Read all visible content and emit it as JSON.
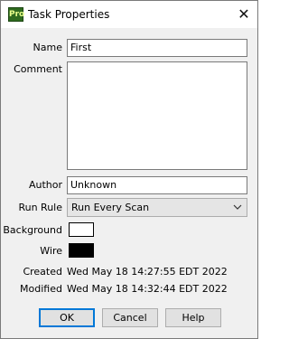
{
  "window": {
    "title": "Task Properties",
    "app_icon_text": "Pro",
    "close_glyph": "✕"
  },
  "form": {
    "name": {
      "label": "Name",
      "value": "First"
    },
    "comment": {
      "label": "Comment",
      "value": ""
    },
    "author": {
      "label": "Author",
      "value": "Unknown"
    },
    "run_rule": {
      "label": "Run Rule",
      "value": "Run Every Scan"
    },
    "background": {
      "label": "Background",
      "color": "#ffffff"
    },
    "wire": {
      "label": "Wire",
      "color": "#000000"
    },
    "created": {
      "label": "Created",
      "value": "Wed May 18 14:27:55 EDT 2022"
    },
    "modified": {
      "label": "Modified",
      "value": "Wed May 18 14:32:44 EDT 2022"
    }
  },
  "buttons": {
    "ok": "OK",
    "cancel": "Cancel",
    "help": "Help"
  }
}
